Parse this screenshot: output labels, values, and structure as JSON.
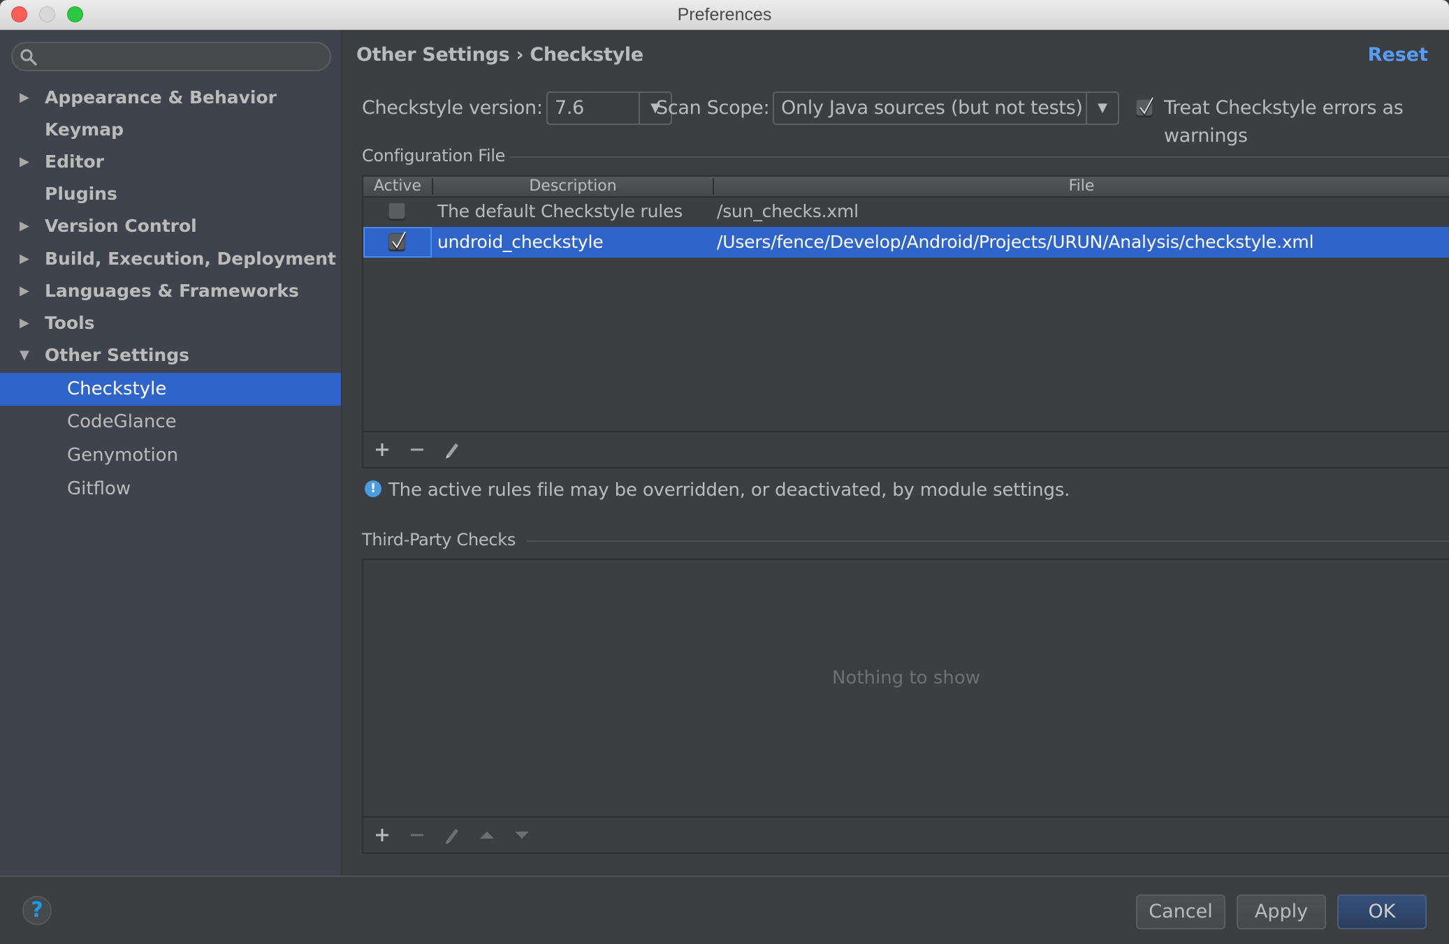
{
  "window": {
    "title": "Preferences"
  },
  "sidebar": {
    "search": {
      "placeholder": "",
      "value": ""
    },
    "items": [
      {
        "label": "Appearance & Behavior",
        "expandable": true,
        "expanded": false
      },
      {
        "label": "Keymap",
        "expandable": false
      },
      {
        "label": "Editor",
        "expandable": true,
        "expanded": false
      },
      {
        "label": "Plugins",
        "expandable": false
      },
      {
        "label": "Version Control",
        "expandable": true,
        "expanded": false
      },
      {
        "label": "Build, Execution, Deployment",
        "expandable": true,
        "expanded": false
      },
      {
        "label": "Languages & Frameworks",
        "expandable": true,
        "expanded": false
      },
      {
        "label": "Tools",
        "expandable": true,
        "expanded": false
      },
      {
        "label": "Other Settings",
        "expandable": true,
        "expanded": true
      }
    ],
    "children": [
      {
        "label": "Checkstyle",
        "selected": true
      },
      {
        "label": "CodeGlance",
        "selected": false
      },
      {
        "label": "Genymotion",
        "selected": false
      },
      {
        "label": "Gitflow",
        "selected": false
      }
    ],
    "arrow_collapsed": "▶",
    "arrow_expanded": "▼"
  },
  "header": {
    "breadcrumb": "Other Settings › Checkstyle",
    "reset_label": "Reset"
  },
  "settings": {
    "version_label": "Checkstyle version:",
    "version_value": "7.6",
    "scope_label": "Scan Scope:",
    "scope_value": "Only Java sources (but not tests)",
    "treat_errors_label": "Treat Checkstyle errors as warnings",
    "treat_errors_checked": true,
    "dropdown_arrow": "▼"
  },
  "config_file": {
    "section_title": "Configuration File",
    "columns": [
      "Active",
      "Description",
      "File"
    ],
    "rows": [
      {
        "active": false,
        "description": "The default Checkstyle rules",
        "file": "/sun_checks.xml",
        "selected": false
      },
      {
        "active": true,
        "description": "undroid_checkstyle",
        "file": "/Users/fence/Develop/Android/Projects/URUN/Analysis/checkstyle.xml",
        "selected": true
      }
    ],
    "toolbar": [
      "add",
      "remove",
      "edit"
    ],
    "info_icon": "!",
    "info_text": "The active rules file may be overridden, or deactivated, by module settings."
  },
  "third_party": {
    "section_title": "Third-Party Checks",
    "empty_text": "Nothing to show",
    "toolbar": [
      "add",
      "remove",
      "edit",
      "move-up",
      "move-down"
    ]
  },
  "footer": {
    "help_icon": "?",
    "cancel_label": "Cancel",
    "apply_label": "Apply",
    "ok_label": "OK"
  },
  "colors": {
    "selection": "#2f65ca",
    "link": "#589df6",
    "sidebar_bg": "#3f434c",
    "panel_bg": "#3c3f41"
  }
}
